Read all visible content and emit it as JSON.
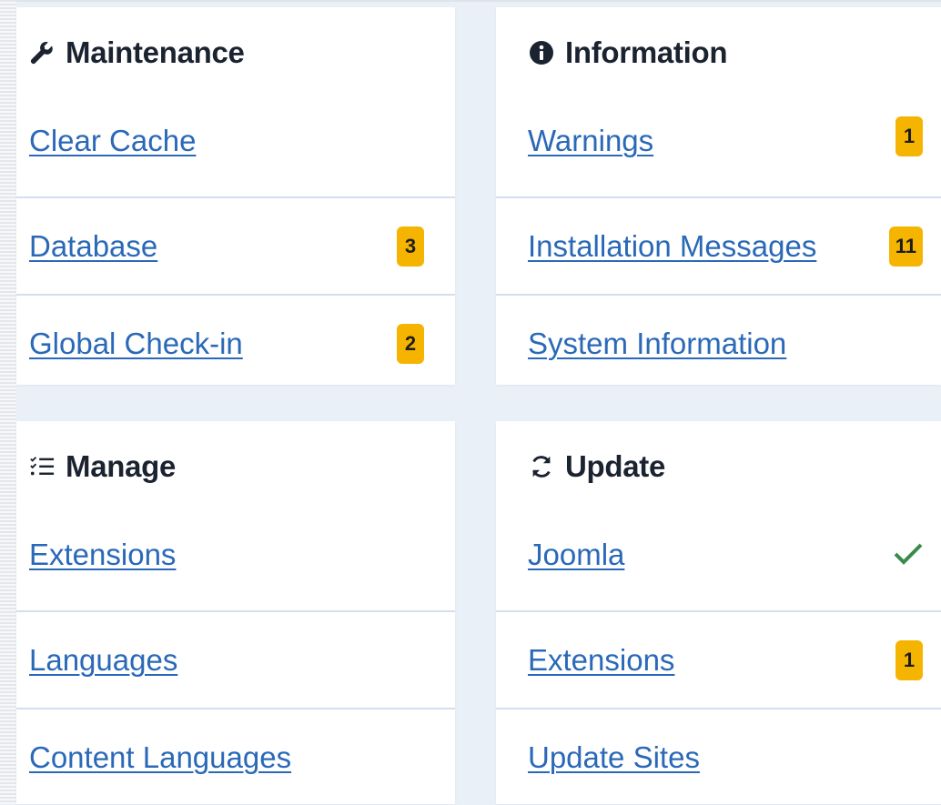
{
  "maintenance": {
    "title": "Maintenance",
    "icon": "wrench-icon",
    "items": [
      {
        "label": "Clear Cache",
        "badge": ""
      },
      {
        "label": "Database",
        "badge": "3"
      },
      {
        "label": "Global Check-in",
        "badge": "2"
      }
    ]
  },
  "information": {
    "title": "Information",
    "icon": "info-circle-icon",
    "items": [
      {
        "label": "Warnings",
        "badge": "1"
      },
      {
        "label": "Installation Messages",
        "badge": "11"
      },
      {
        "label": "System Information",
        "badge": ""
      }
    ]
  },
  "manage": {
    "title": "Manage",
    "icon": "checklist-icon",
    "items": [
      {
        "label": "Extensions"
      },
      {
        "label": "Languages"
      },
      {
        "label": "Content Languages"
      }
    ]
  },
  "update": {
    "title": "Update",
    "icon": "refresh-icon",
    "items": [
      {
        "label": "Joomla",
        "status": "check-icon"
      },
      {
        "label": "Extensions",
        "badge": "1"
      },
      {
        "label": "Update Sites"
      }
    ]
  },
  "colors": {
    "link": "#2a69b8",
    "badge": "#f5b400",
    "check": "#3a8a4a",
    "background": "#eaf0f8"
  }
}
